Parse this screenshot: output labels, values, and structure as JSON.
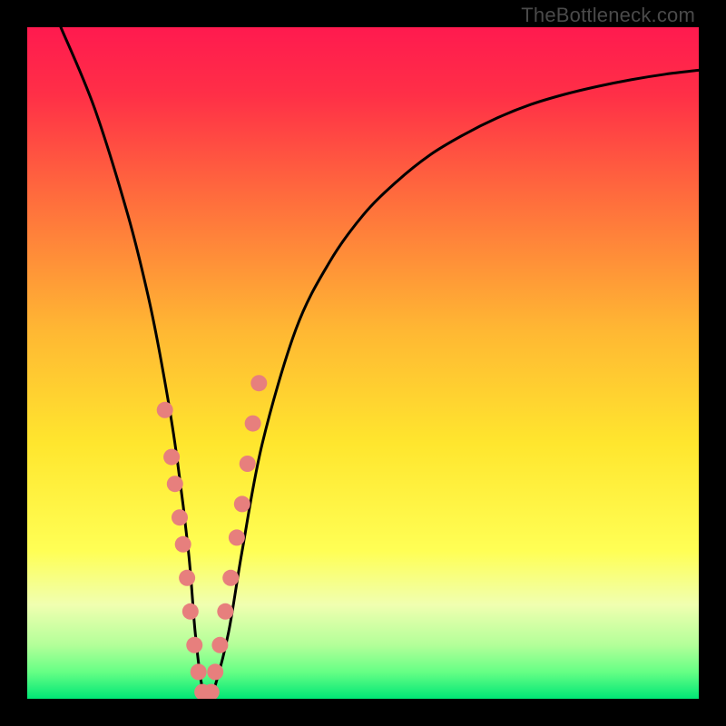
{
  "watermark": "TheBottleneck.com",
  "gradient": {
    "stops": [
      {
        "pos": 0.0,
        "color": "#ff1a4f"
      },
      {
        "pos": 0.1,
        "color": "#ff2f47"
      },
      {
        "pos": 0.25,
        "color": "#ff6b3d"
      },
      {
        "pos": 0.45,
        "color": "#ffb733"
      },
      {
        "pos": 0.62,
        "color": "#ffe62e"
      },
      {
        "pos": 0.78,
        "color": "#ffff55"
      },
      {
        "pos": 0.86,
        "color": "#f0ffb0"
      },
      {
        "pos": 0.92,
        "color": "#b3ff99"
      },
      {
        "pos": 0.96,
        "color": "#66ff85"
      },
      {
        "pos": 1.0,
        "color": "#00e676"
      }
    ]
  },
  "chart_data": {
    "type": "line",
    "title": "",
    "xlabel": "",
    "ylabel": "",
    "xlim": [
      0,
      100
    ],
    "ylim": [
      0,
      100
    ],
    "series": [
      {
        "name": "bottleneck-curve",
        "x": [
          5,
          10,
          15,
          18,
          20,
          22,
          24,
          25,
          26,
          27,
          28,
          30,
          32,
          35,
          40,
          45,
          50,
          55,
          60,
          65,
          70,
          75,
          80,
          85,
          90,
          95,
          100
        ],
        "y": [
          100,
          88,
          72,
          60,
          50,
          38,
          22,
          10,
          2,
          0,
          2,
          10,
          22,
          38,
          55,
          65,
          72,
          77,
          81,
          84,
          86.5,
          88.5,
          90,
          91.2,
          92.2,
          93,
          93.6
        ]
      }
    ],
    "scatter": {
      "name": "highlight-points",
      "color": "#e77f7d",
      "radius": 9,
      "x": [
        20.5,
        21.5,
        22.0,
        22.7,
        23.2,
        23.8,
        24.3,
        24.9,
        25.5,
        26.1,
        26.8,
        27.4,
        28.0,
        28.7,
        29.5,
        30.3,
        31.2,
        32.0,
        32.8,
        33.6,
        34.5
      ],
      "y": [
        43,
        36,
        32,
        27,
        23,
        18,
        13,
        8,
        4,
        1,
        0,
        1,
        4,
        8,
        13,
        18,
        24,
        29,
        35,
        41,
        47
      ]
    }
  }
}
